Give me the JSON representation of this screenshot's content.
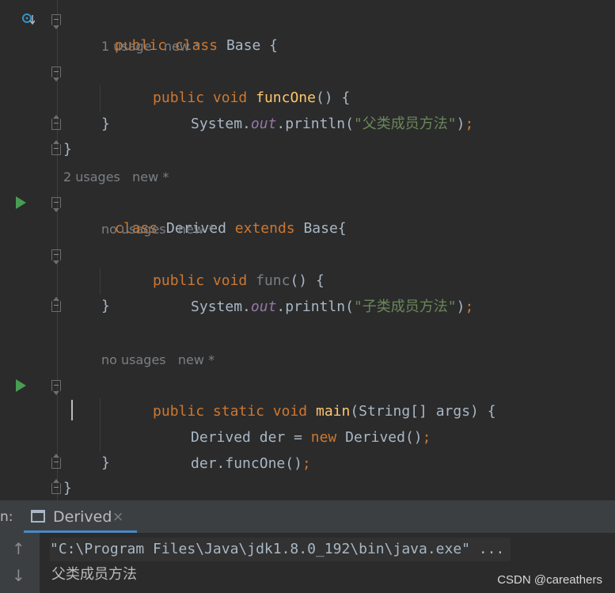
{
  "editor": {
    "lines": {
      "l1": {
        "kw1": "public",
        "kw2": "class",
        "rest": "Base {"
      },
      "hint1": {
        "usages": "1 usage",
        "mod": "new *"
      },
      "l2": {
        "kw1": "public",
        "kw2": "void",
        "fn": "funcOne",
        "rest": "() {"
      },
      "l3": {
        "a": "System.",
        "fld": "out",
        "b": ".println(",
        "str": "\"父类成员方法\"",
        "c": ")",
        "semi": ";"
      },
      "l4": {
        "rest": "}"
      },
      "l5": {
        "rest": "}"
      },
      "hint2": {
        "usages": "2 usages",
        "mod": "new *"
      },
      "l6": {
        "kw1": "class",
        "b": " Derived ",
        "kw2": "extends",
        "rest": " Base{"
      },
      "hint3": {
        "usages": "no usages",
        "mod": "new *"
      },
      "l7": {
        "kw1": "public",
        "kw2": "void",
        "fn": "func",
        "rest": "() {"
      },
      "l8": {
        "a": "System.",
        "fld": "out",
        "b": ".println(",
        "str": "\"子类成员方法\"",
        "c": ")",
        "semi": ";"
      },
      "l9": {
        "rest": "}"
      },
      "hint4": {
        "usages": "no usages",
        "mod": "new *"
      },
      "l10": {
        "kw1": "public",
        "kw2": "static",
        "kw3": "void",
        "fn": "main",
        "rest": "(String[] args) {"
      },
      "l11": {
        "a": "Derived der = ",
        "kw": "new",
        "b": " Derived()",
        "semi": ";"
      },
      "l12": {
        "a": "der.funcOne()",
        "semi": ";"
      },
      "l13": {
        "rest": "}"
      },
      "l14": {
        "rest": "}"
      }
    }
  },
  "run_panel": {
    "prefix": "n:",
    "tab_label": "Derived",
    "tab_close": "×",
    "command": "\"C:\\Program Files\\Java\\jdk1.8.0_192\\bin\\java.exe\" ...",
    "output": "父类成员方法",
    "up_arrow": "↑",
    "down_arrow": "↓"
  },
  "watermark": "CSDN @careathers",
  "icons": [
    "implemented-method-icon",
    "run-gutter-icon",
    "fold-icon",
    "console-icon",
    "close-icon",
    "arrow-up-icon",
    "arrow-down-icon"
  ],
  "colors": {
    "keyword": "#cc7832",
    "function": "#ffc66d",
    "string": "#6a8759",
    "field": "#9876aa",
    "run": "#499c54",
    "accent": "#4a88c7"
  }
}
